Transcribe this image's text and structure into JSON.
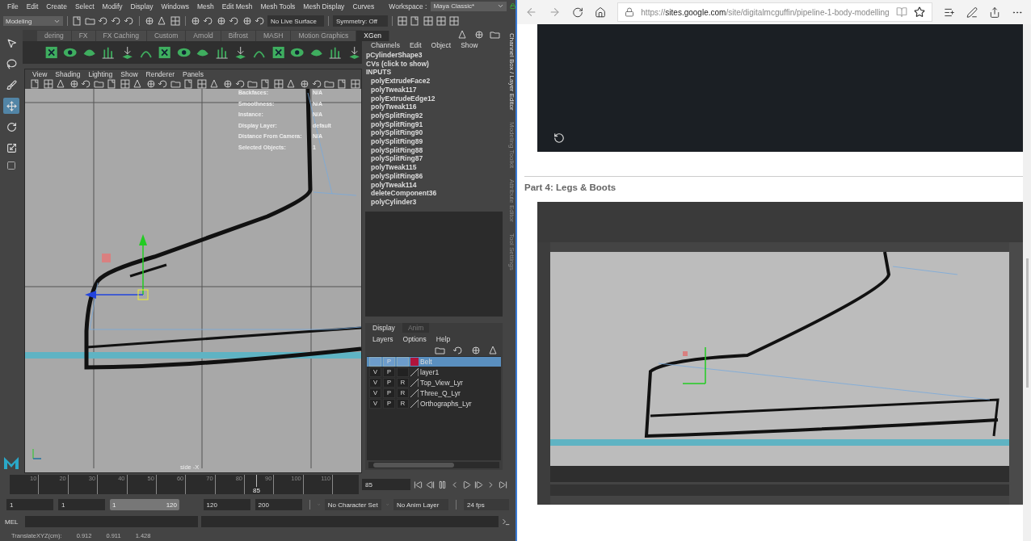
{
  "maya": {
    "menubar": {
      "menus": [
        "File",
        "Edit",
        "Create",
        "Select",
        "Modify",
        "Display",
        "Windows",
        "Mesh",
        "Edit Mesh",
        "Mesh Tools",
        "Mesh Display",
        "Curves"
      ],
      "workspace_label": "Workspace :",
      "workspace": "Maya Classic*"
    },
    "status_line": {
      "mode": "Modeling",
      "live_surface": "No Live Surface",
      "symmetry": "Symmetry: Off"
    },
    "shelf": {
      "tabs": [
        {
          "label": "dering",
          "selected": false
        },
        {
          "label": "FX",
          "selected": false
        },
        {
          "label": "FX Caching",
          "selected": false
        },
        {
          "label": "Custom",
          "selected": false
        },
        {
          "label": "Arnold",
          "selected": false
        },
        {
          "label": "Bifrost",
          "selected": false
        },
        {
          "label": "MASH",
          "selected": false
        },
        {
          "label": "Motion Graphics",
          "selected": false
        },
        {
          "label": "XGen",
          "selected": true
        }
      ]
    },
    "viewport": {
      "menus": [
        "View",
        "Shading",
        "Lighting",
        "Show",
        "Renderer",
        "Panels"
      ],
      "hud": [
        {
          "label": "Backfaces:",
          "value": "N/A"
        },
        {
          "label": "Smoothness:",
          "value": "N/A"
        },
        {
          "label": "Instance:",
          "value": "N/A"
        },
        {
          "label": "Display Layer:",
          "value": "default"
        },
        {
          "label": "Distance From Camera:",
          "value": "N/A"
        },
        {
          "label": "Selected Objects:",
          "value": "1"
        }
      ],
      "camera": "side -X"
    },
    "channel_box": {
      "menus": [
        "Channels",
        "Edit",
        "Object",
        "Show"
      ],
      "object": "pCylinderShape3",
      "cvs": "CVs (click to show)",
      "inputs_header": "INPUTS",
      "inputs": [
        "polyExtrudeFace2",
        "polyTweak117",
        "polyExtrudeEdge12",
        "polyTweak116",
        "polySplitRing92",
        "polySplitRing91",
        "polySplitRing90",
        "polySplitRing89",
        "polySplitRing88",
        "polySplitRing87",
        "polyTweak115",
        "polySplitRing86",
        "polyTweak114",
        "deleteComponent36",
        "polyCylinder3"
      ]
    },
    "side_tabs": [
      "Channel Box / Layer Editor",
      "Modeling Toolkit",
      "Attribute Editor",
      "Tool Settings"
    ],
    "layer_editor": {
      "tabs": [
        {
          "label": "Display",
          "selected": true
        },
        {
          "label": "Anim",
          "selected": false
        }
      ],
      "menus": [
        "Layers",
        "Options",
        "Help"
      ],
      "layers": [
        {
          "p": "P",
          "name": "Belt",
          "selected": true,
          "color": "#b0143c"
        },
        {
          "v": "V",
          "p": "P",
          "name": "layer1",
          "selected": false
        },
        {
          "v": "V",
          "p": "P",
          "r": "R",
          "name": "Top_View_Lyr",
          "selected": false
        },
        {
          "v": "V",
          "p": "P",
          "r": "R",
          "name": "Three_Q_Lyr",
          "selected": false
        },
        {
          "v": "V",
          "p": "P",
          "r": "R",
          "name": "Orthographs_Lyr",
          "selected": false
        }
      ]
    },
    "timeline": {
      "ticks": [
        "10",
        "20",
        "30",
        "40",
        "50",
        "60",
        "70",
        "80",
        "90",
        "100",
        "110"
      ],
      "current": "85",
      "level": 0.707,
      "frame_field": "85"
    },
    "range": {
      "level": 1,
      "start": "1",
      "playback_start": "1",
      "range_start": "1",
      "range_end": "120",
      "playback_end": "120",
      "end": "200",
      "character_set": "No Character Set",
      "anim_layer": "No Anim Layer",
      "fps": "24 fps"
    },
    "command_line": {
      "label": "MEL"
    },
    "help_line": {
      "label": "TranslateXYZ(cm):",
      "values": [
        "0.912",
        "0.911",
        "1.428"
      ]
    }
  },
  "browser": {
    "url_scheme": "https://",
    "url_host": "sites.google.com",
    "url_path": "/site/digitalmcguffin/pipeline-1-body-modelling",
    "article": {
      "heading": "Part 4: Legs & Boots"
    }
  }
}
